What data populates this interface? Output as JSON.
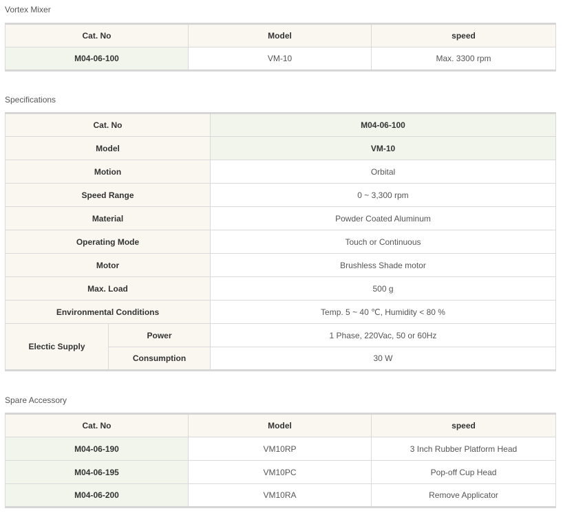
{
  "vortex": {
    "title": "Vortex Mixer",
    "headers": [
      "Cat. No",
      "Model",
      "speed"
    ],
    "row": {
      "cat": "M04-06-100",
      "model": "VM-10",
      "speed": "Max. 3300 rpm"
    }
  },
  "specs": {
    "title": "Specifications",
    "rows": [
      {
        "label": "Cat. No",
        "value": "M04-06-100"
      },
      {
        "label": "Model",
        "value": "VM-10"
      },
      {
        "label": "Motion",
        "value": "Orbital"
      },
      {
        "label": "Speed Range",
        "value": "0 ~ 3,300 rpm"
      },
      {
        "label": "Material",
        "value": "Powder Coated Aluminum"
      },
      {
        "label": "Operating Mode",
        "value": "Touch or Continuous"
      },
      {
        "label": "Motor",
        "value": "Brushless Shade motor"
      },
      {
        "label": "Max. Load",
        "value": "500 g"
      },
      {
        "label": "Environmental Conditions",
        "value": "Temp. 5 ~ 40 ℃, Humidity < 80 %"
      }
    ],
    "electric": {
      "label": "Electic Supply",
      "power_label": "Power",
      "power_value": "1 Phase, 220Vac, 50 or 60Hz",
      "consumption_label": "Consumption",
      "consumption_value": "30 W"
    }
  },
  "spare": {
    "title": "Spare Accessory",
    "headers": [
      "Cat. No",
      "Model",
      "speed"
    ],
    "rows": [
      {
        "cat": "M04-06-190",
        "model": "VM10RP",
        "speed": "3 Inch Rubber Platform Head"
      },
      {
        "cat": "M04-06-195",
        "model": "VM10PC",
        "speed": "Pop-off Cup Head"
      },
      {
        "cat": "M04-06-200",
        "model": "VM10RA",
        "speed": "Remove Applicator"
      }
    ]
  }
}
